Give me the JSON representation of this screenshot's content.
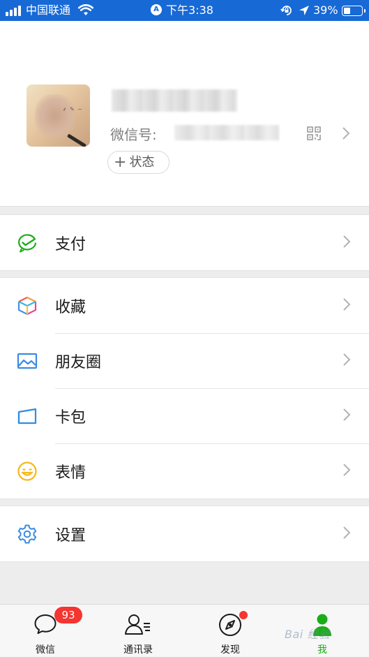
{
  "status_bar": {
    "carrier": "中国联通",
    "time": "下午3:38",
    "battery_percent": "39%",
    "battery_level": 0.39,
    "icons": [
      "signal-icon",
      "wifi-icon",
      "alarm-a-icon",
      "rotation-lock-icon",
      "location-arrow-icon",
      "battery-icon"
    ]
  },
  "profile": {
    "wechat_id_label": "微信号:",
    "status_button_label": "状态",
    "status_button_icon": "plus-icon",
    "qr_icon": "qr-code-icon"
  },
  "menu": {
    "groups": [
      [
        {
          "label": "支付",
          "icon": "pay-icon"
        }
      ],
      [
        {
          "label": "收藏",
          "icon": "favorites-cube-icon"
        },
        {
          "label": "朋友圈",
          "icon": "moments-photo-icon"
        },
        {
          "label": "卡包",
          "icon": "card-wallet-icon"
        },
        {
          "label": "表情",
          "icon": "smiley-icon"
        }
      ],
      [
        {
          "label": "设置",
          "icon": "gear-icon"
        }
      ]
    ]
  },
  "tabbar": {
    "tabs": [
      {
        "label": "微信",
        "icon": "chat-bubble-icon",
        "badge": "93"
      },
      {
        "label": "通讯录",
        "icon": "contacts-icon"
      },
      {
        "label": "发现",
        "icon": "compass-icon",
        "dot": true
      },
      {
        "label": "我",
        "icon": "me-person-icon",
        "active": true
      }
    ]
  },
  "watermark": "Bai 经验",
  "colors": {
    "status_bar": "#1769d6",
    "accent_green": "#1aad19",
    "badge_red": "#f43530",
    "background": "#ededed"
  }
}
